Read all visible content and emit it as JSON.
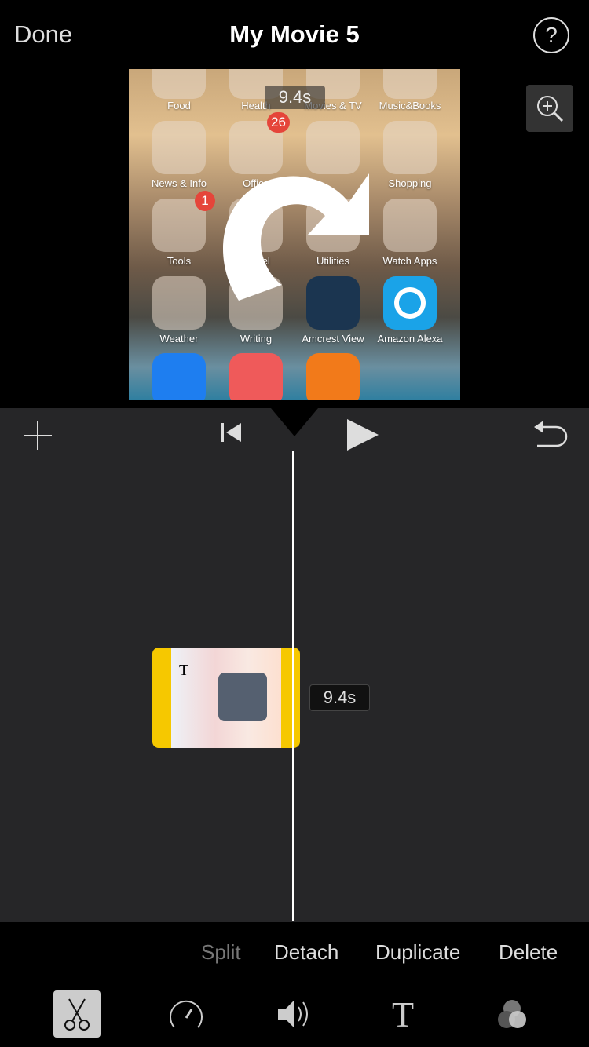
{
  "header": {
    "done_label": "Done",
    "title": "My Movie 5",
    "help_label": "?"
  },
  "preview": {
    "time_overlay": "9.4s",
    "folders": [
      "Food",
      "Health",
      "Movies & TV",
      "Music&Books",
      "News & Info",
      "Office",
      "Shopping",
      "Tools",
      "Travel",
      "Utilities",
      "Watch Apps",
      "Weather",
      "Writing",
      "Amcrest View",
      "Amazon Alexa"
    ],
    "badges": {
      "office": "26",
      "tools": "1"
    },
    "overlay_icon": "rotate-clockwise-icon"
  },
  "controls": {
    "add_icon": "plus-icon",
    "skip_back_icon": "skip-to-start-icon",
    "play_icon": "play-icon",
    "undo_icon": "undo-icon"
  },
  "timeline": {
    "clip_duration": "9.4s",
    "clip_title_icon": "T",
    "clip_color": "#f6c800"
  },
  "actions": {
    "split": "Split",
    "detach": "Detach",
    "duplicate": "Duplicate",
    "delete": "Delete"
  },
  "tools": [
    {
      "icon": "scissors-icon",
      "selected": true
    },
    {
      "icon": "speedometer-icon",
      "selected": false
    },
    {
      "icon": "volume-icon",
      "selected": false
    },
    {
      "icon": "title-text-icon",
      "label": "T",
      "selected": false
    },
    {
      "icon": "filters-icon",
      "selected": false
    }
  ]
}
